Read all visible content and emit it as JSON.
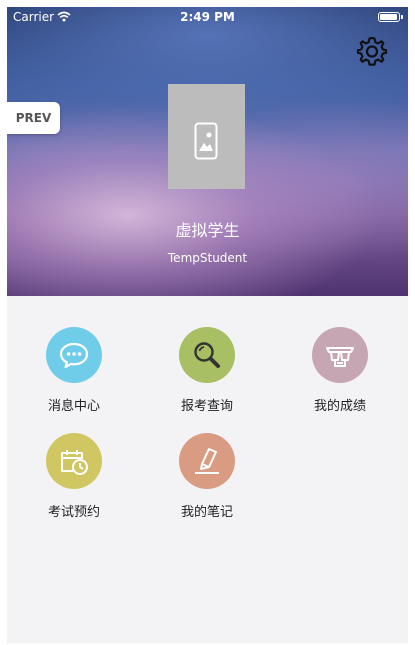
{
  "status_bar": {
    "carrier": "Carrier",
    "time": "2:49 PM",
    "battery_level": 1.0
  },
  "profile": {
    "display_name": "虚拟学生",
    "username": "TempStudent"
  },
  "prev_label": "PREV",
  "menu": [
    {
      "label": "消息中心",
      "icon": "chat-bubble-icon",
      "color": "#6fcdea"
    },
    {
      "label": "报考查询",
      "icon": "magnifier-icon",
      "color": "#a8bf63"
    },
    {
      "label": "我的成绩",
      "icon": "trophy-icon",
      "color": "#c7a6b4"
    },
    {
      "label": "考试预约",
      "icon": "calendar-clock-icon",
      "color": "#d1c762"
    },
    {
      "label": "我的笔记",
      "icon": "pen-note-icon",
      "color": "#d99c83"
    }
  ]
}
